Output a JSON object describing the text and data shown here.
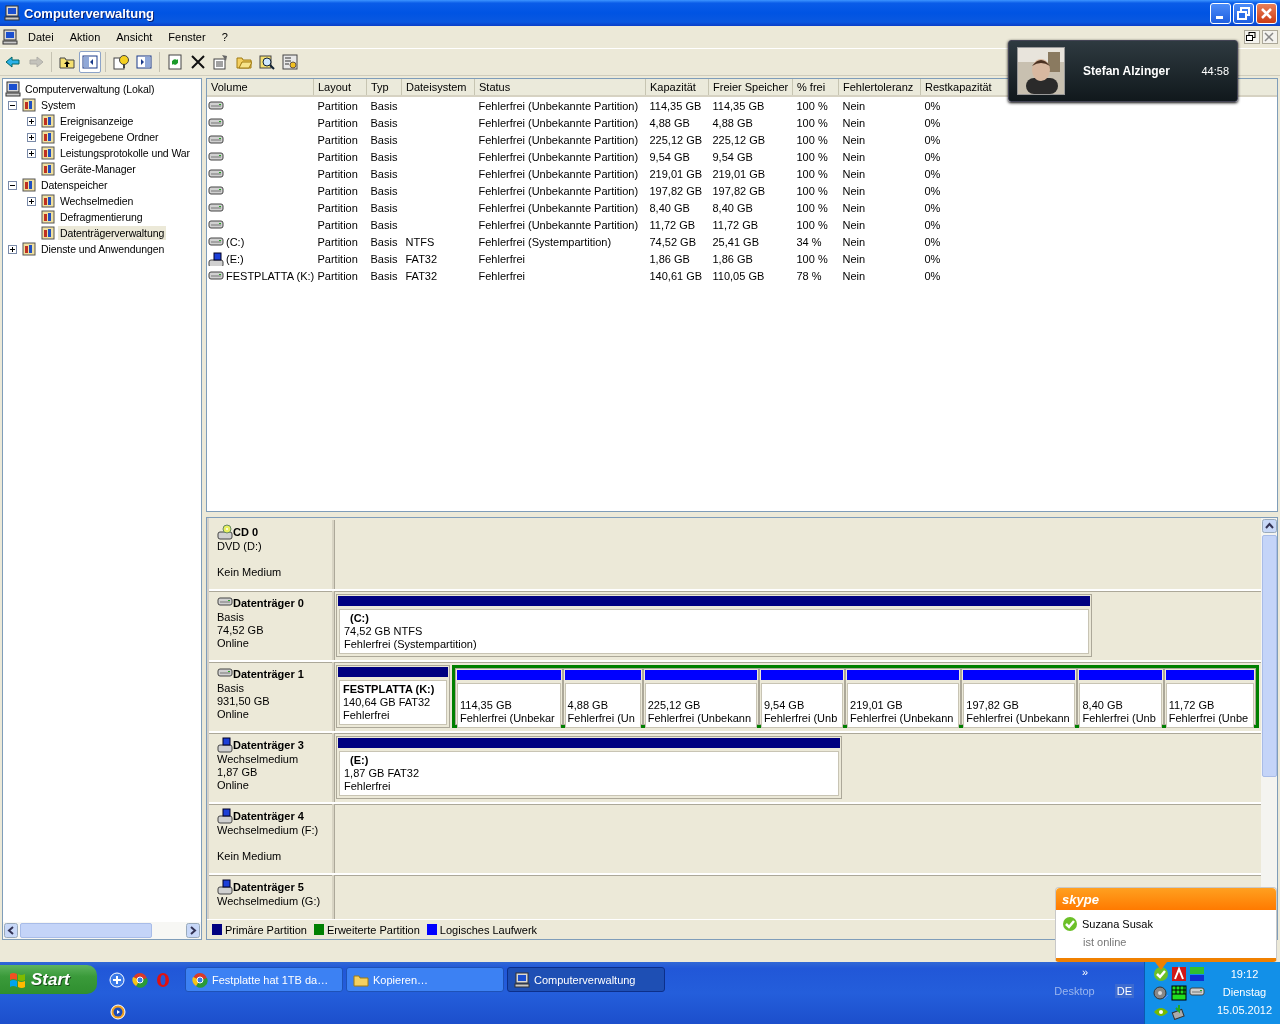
{
  "window": {
    "title": "Computerverwaltung"
  },
  "menu": [
    "Datei",
    "Aktion",
    "Ansicht",
    "Fenster",
    "?"
  ],
  "toolbar": [
    {
      "pressed": false,
      "disabled": false
    },
    {
      "pressed": false,
      "disabled": true
    },
    {
      "pressed": false,
      "disabled": false
    },
    {
      "pressed": true,
      "disabled": false
    },
    {
      "pressed": false,
      "disabled": false
    },
    {
      "pressed": false,
      "disabled": false
    },
    {
      "pressed": false,
      "disabled": false
    },
    {
      "pressed": false,
      "disabled": false
    },
    {
      "pressed": false,
      "disabled": false
    },
    {
      "pressed": false,
      "disabled": false
    },
    {
      "pressed": false,
      "disabled": false
    },
    {
      "pressed": false,
      "disabled": false
    }
  ],
  "tree": {
    "items": [
      {
        "label": "Computerverwaltung (Lokal)",
        "selected": false,
        "children": [
          {
            "label": "System",
            "expanded": true,
            "selected": false,
            "children": [
              {
                "label": "Ereignisanzeige",
                "expanded": false,
                "selected": false
              },
              {
                "label": "Freigegebene Ordner",
                "expanded": false,
                "selected": false
              },
              {
                "label": "Leistungsprotokolle und War",
                "expanded": false,
                "selected": false
              },
              {
                "label": "Geräte-Manager",
                "selected": false
              }
            ]
          },
          {
            "label": "Datenspeicher",
            "expanded": true,
            "selected": false,
            "children": [
              {
                "label": "Wechselmedien",
                "expanded": false,
                "selected": false
              },
              {
                "label": "Defragmentierung",
                "selected": false
              },
              {
                "label": "Datenträgerverwaltung",
                "selected": true
              }
            ]
          },
          {
            "label": "Dienste und Anwendungen",
            "expanded": false,
            "selected": false
          }
        ]
      }
    ]
  },
  "table": {
    "columns": [
      "Volume",
      "Layout",
      "Typ",
      "Dateisystem",
      "Status",
      "Kapazität",
      "Freier Speicher",
      "% frei",
      "Fehlertoleranz",
      "Restkapazität"
    ],
    "rows": [
      {
        "kind": "disk",
        "layout": "Partition",
        "type": "Basis",
        "status": "Fehlerfrei (Unbekannte Partition)",
        "capacity": "114,35 GB",
        "free": "114,35 GB",
        "percent": "100 %",
        "fault_tolerance": "Nein",
        "overhead": "0%"
      },
      {
        "kind": "disk",
        "layout": "Partition",
        "type": "Basis",
        "status": "Fehlerfrei (Unbekannte Partition)",
        "capacity": "4,88 GB",
        "free": "4,88 GB",
        "percent": "100 %",
        "fault_tolerance": "Nein",
        "overhead": "0%"
      },
      {
        "kind": "disk",
        "layout": "Partition",
        "type": "Basis",
        "status": "Fehlerfrei (Unbekannte Partition)",
        "capacity": "225,12 GB",
        "free": "225,12 GB",
        "percent": "100 %",
        "fault_tolerance": "Nein",
        "overhead": "0%"
      },
      {
        "kind": "disk",
        "layout": "Partition",
        "type": "Basis",
        "status": "Fehlerfrei (Unbekannte Partition)",
        "capacity": "9,54 GB",
        "free": "9,54 GB",
        "percent": "100 %",
        "fault_tolerance": "Nein",
        "overhead": "0%"
      },
      {
        "kind": "disk",
        "layout": "Partition",
        "type": "Basis",
        "status": "Fehlerfrei (Unbekannte Partition)",
        "capacity": "219,01 GB",
        "free": "219,01 GB",
        "percent": "100 %",
        "fault_tolerance": "Nein",
        "overhead": "0%"
      },
      {
        "kind": "disk",
        "layout": "Partition",
        "type": "Basis",
        "status": "Fehlerfrei (Unbekannte Partition)",
        "capacity": "197,82 GB",
        "free": "197,82 GB",
        "percent": "100 %",
        "fault_tolerance": "Nein",
        "overhead": "0%"
      },
      {
        "kind": "disk",
        "layout": "Partition",
        "type": "Basis",
        "status": "Fehlerfrei (Unbekannte Partition)",
        "capacity": "8,40 GB",
        "free": "8,40 GB",
        "percent": "100 %",
        "fault_tolerance": "Nein",
        "overhead": "0%"
      },
      {
        "kind": "disk",
        "layout": "Partition",
        "type": "Basis",
        "status": "Fehlerfrei (Unbekannte Partition)",
        "capacity": "11,72 GB",
        "free": "11,72 GB",
        "percent": "100 %",
        "fault_tolerance": "Nein",
        "overhead": "0%"
      },
      {
        "kind": "disk",
        "volume": "(C:)",
        "layout": "Partition",
        "type": "Basis",
        "filesystem": "NTFS",
        "status": "Fehlerfrei (Systempartition)",
        "capacity": "74,52 GB",
        "free": "25,41 GB",
        "percent": "34 %",
        "fault_tolerance": "Nein",
        "overhead": "0%"
      },
      {
        "kind": "removable",
        "volume": "(E:)",
        "layout": "Partition",
        "type": "Basis",
        "filesystem": "FAT32",
        "status": "Fehlerfrei",
        "capacity": "1,86 GB",
        "free": "1,86 GB",
        "percent": "100 %",
        "fault_tolerance": "Nein",
        "overhead": "0%"
      },
      {
        "kind": "disk",
        "volume": "FESTPLATTA (K:)",
        "layout": "Partition",
        "type": "Basis",
        "filesystem": "FAT32",
        "status": "Fehlerfrei",
        "capacity": "140,61 GB",
        "free": "110,05 GB",
        "percent": "78 %",
        "fault_tolerance": "Nein",
        "overhead": "0%"
      }
    ]
  },
  "disks": [
    {
      "kind": "cd",
      "name": "CD 0",
      "type": "DVD (D:)",
      "state": "Kein Medium"
    },
    {
      "kind": "disk",
      "name": "Datenträger 0",
      "type": "Basis",
      "size": "74,52 GB",
      "state": "Online",
      "partitions": [
        {
          "kind": "primary",
          "label": "(C:)",
          "size": "74,52 GB NTFS",
          "status": "Fehlerfrei (Systempartition)"
        }
      ]
    },
    {
      "kind": "disk",
      "name": "Datenträger 1",
      "type": "Basis",
      "size": "931,50 GB",
      "state": "Online",
      "partitions": [
        {
          "kind": "primary",
          "label": "FESTPLATTA  (K:)",
          "size": "140,64 GB FAT32",
          "status": "Fehlerfrei"
        },
        {
          "kind": "extended",
          "children": [
            {
              "kind": "logical",
              "size": "114,35 GB",
              "status": "Fehlerfrei (Unbekar"
            },
            {
              "kind": "logical",
              "size": "4,88 GB",
              "status": "Fehlerfrei (Un"
            },
            {
              "kind": "logical",
              "size": "225,12 GB",
              "status": "Fehlerfrei (Unbekann"
            },
            {
              "kind": "logical",
              "size": "9,54 GB",
              "status": "Fehlerfrei (Unb"
            },
            {
              "kind": "logical",
              "size": "219,01 GB",
              "status": "Fehlerfrei (Unbekann"
            },
            {
              "kind": "logical",
              "size": "197,82 GB",
              "status": "Fehlerfrei (Unbekann"
            },
            {
              "kind": "logical",
              "size": "8,40 GB",
              "status": "Fehlerfrei (Unb"
            },
            {
              "kind": "logical",
              "size": "11,72 GB",
              "status": "Fehlerfrei (Unbe"
            }
          ]
        }
      ]
    },
    {
      "kind": "removable",
      "name": "Datenträger 3",
      "type": "Wechselmedium",
      "size": "1,87 GB",
      "state": "Online",
      "partitions": [
        {
          "kind": "primary",
          "label": "(E:)",
          "size": "1,87 GB FAT32",
          "status": "Fehlerfrei"
        }
      ]
    },
    {
      "kind": "removable",
      "name": "Datenträger 4",
      "type": "Wechselmedium (F:)",
      "state": "Kein Medium"
    },
    {
      "kind": "removable",
      "name": "Datenträger 5",
      "type": "Wechselmedium (G:)"
    }
  ],
  "legend": [
    {
      "label": "Primäre Partition",
      "color": "#000080"
    },
    {
      "label": "Erweiterte Partition",
      "color": "#008000"
    },
    {
      "label": "Logisches Laufwerk",
      "color": "#0000ff"
    }
  ],
  "video_call": {
    "name": "Stefan Alzinger",
    "time": "44:58"
  },
  "skype_popup": {
    "logo": "skype",
    "contact": "Suzana Susak",
    "status": "ist online"
  },
  "taskbar": {
    "start": "Start",
    "tasks": [
      {
        "label": "Festplatte hat 1TB da…",
        "selected": false
      },
      {
        "label": "Kopieren…",
        "selected": false
      },
      {
        "label": "Computerverwaltung",
        "selected": true
      }
    ],
    "chevron": "»",
    "desktop": "Desktop",
    "language": "DE",
    "clock": {
      "time": "19:12",
      "day": "Dienstag",
      "date": "15.05.2012"
    }
  }
}
